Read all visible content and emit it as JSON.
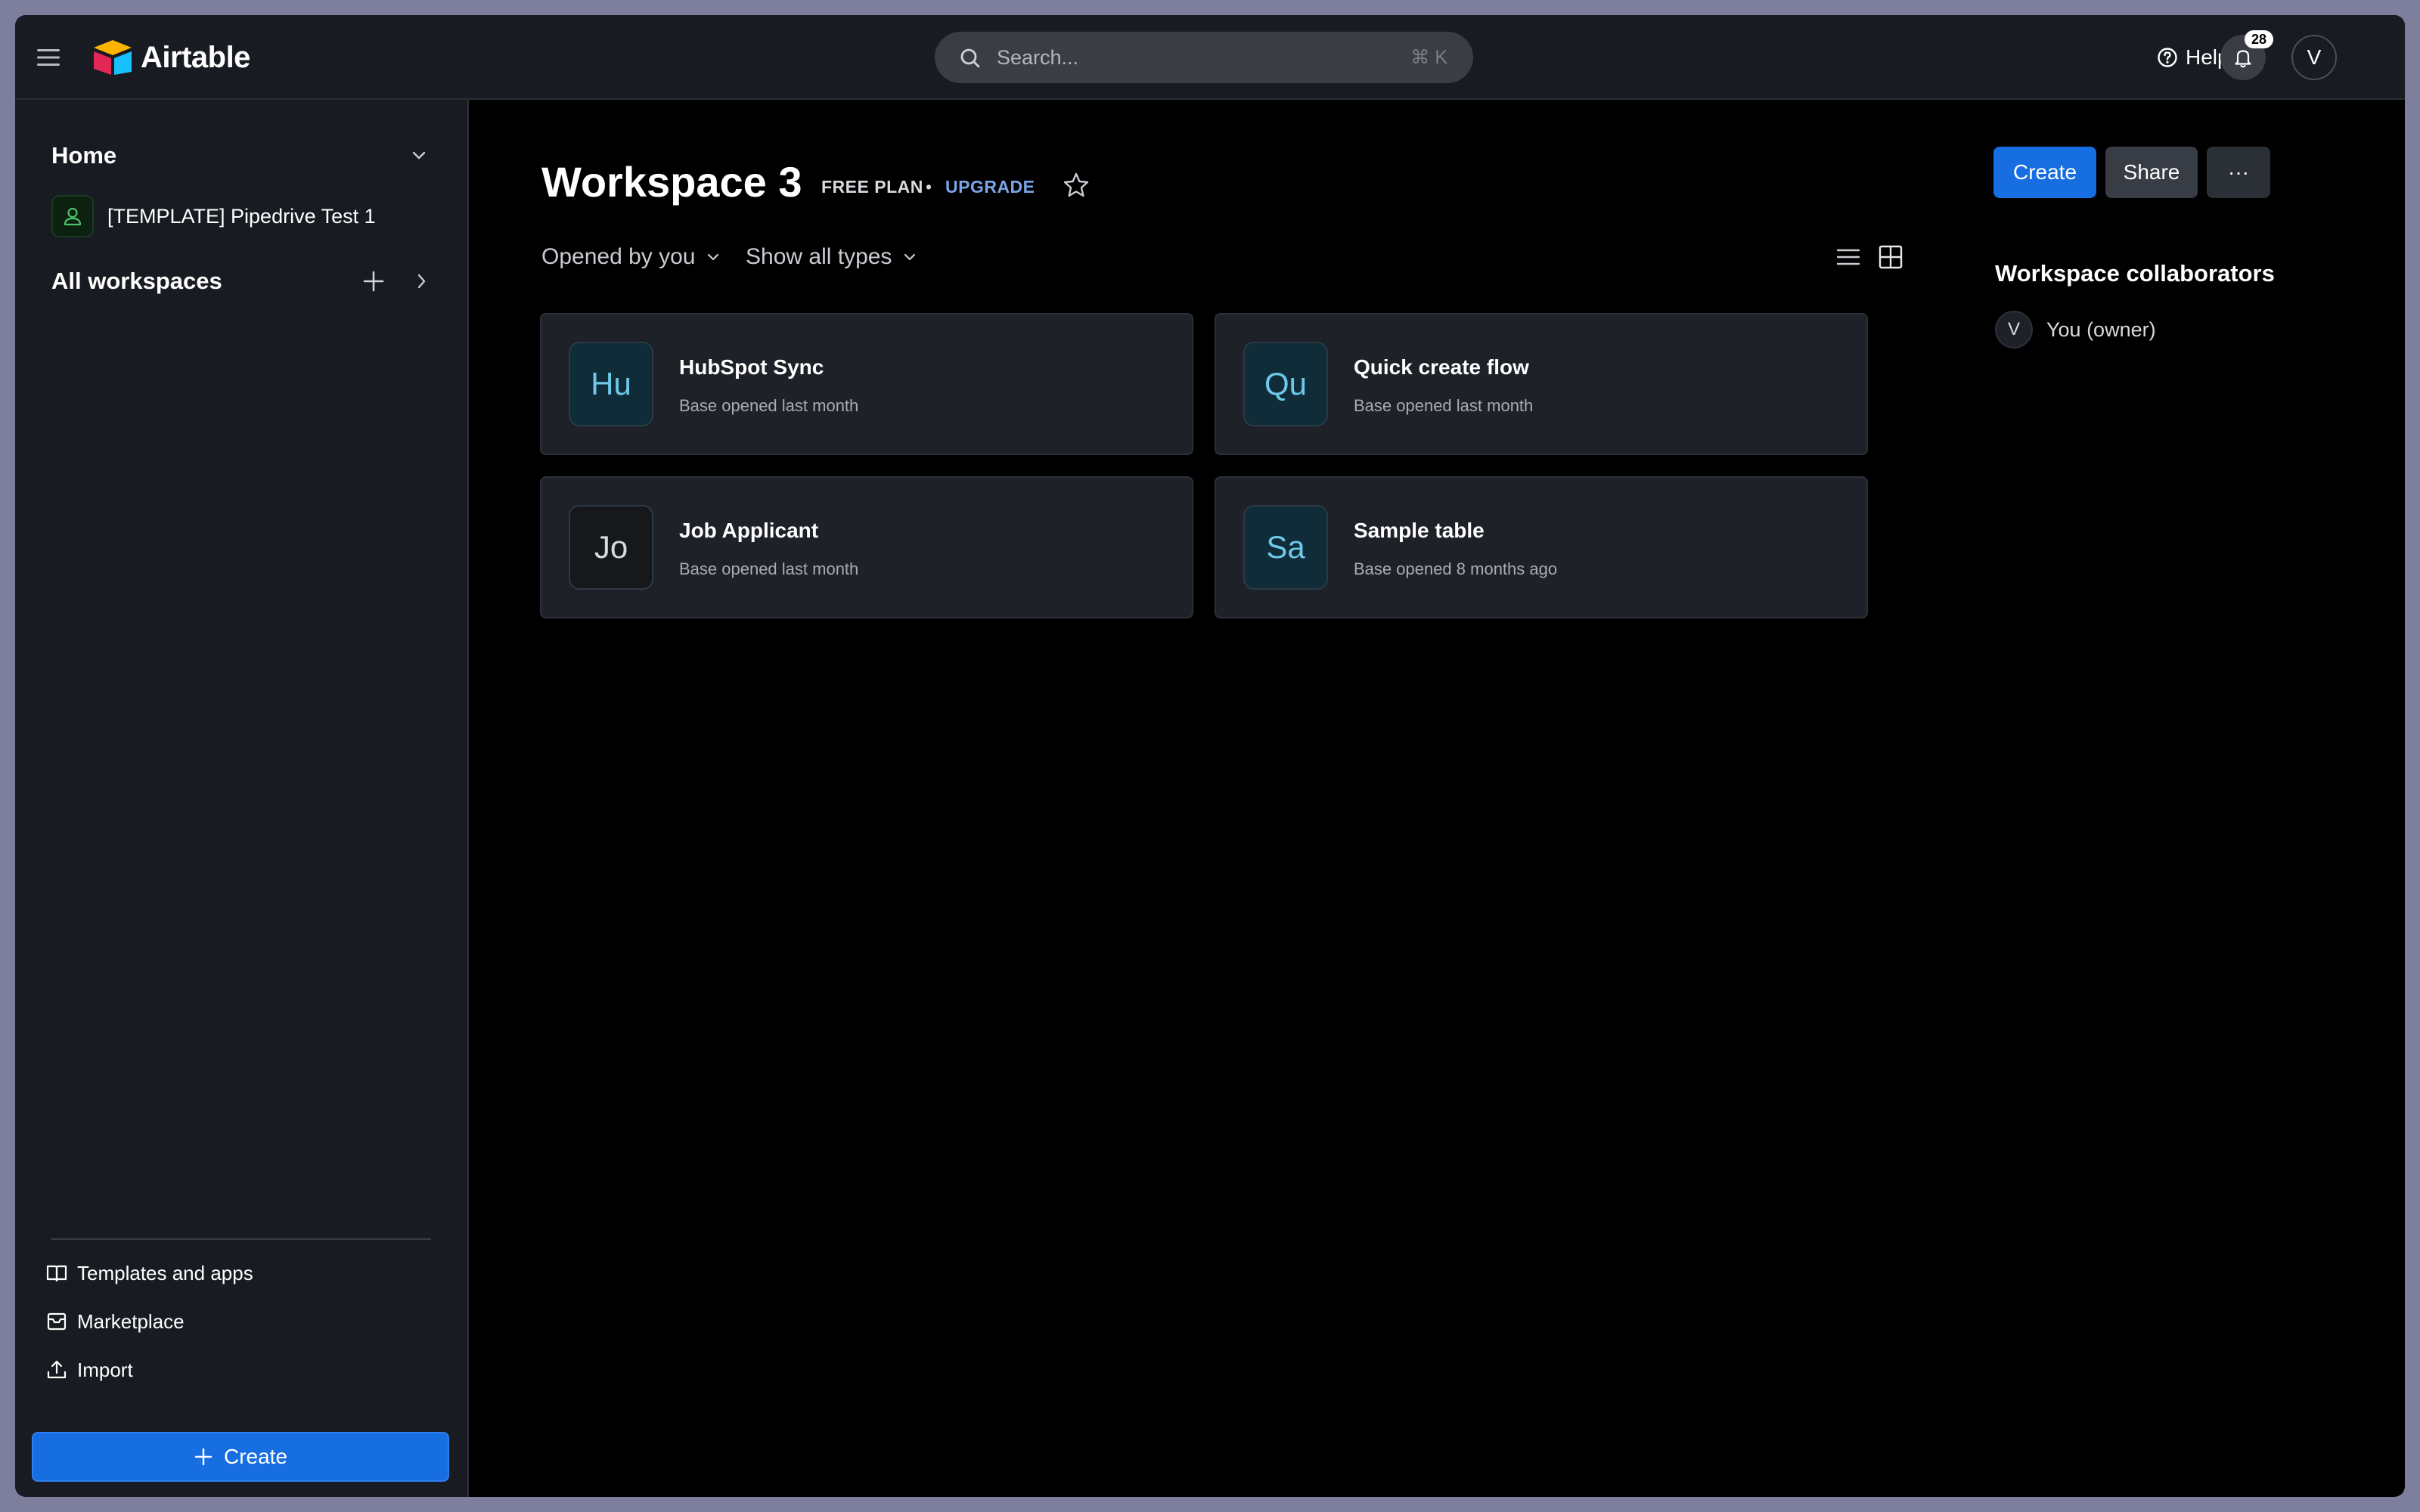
{
  "app": {
    "name": "Airtable"
  },
  "topbar": {
    "search_placeholder": "Search...",
    "search_shortcut": "⌘ K",
    "help_label": "Help",
    "notification_count": "28",
    "avatar_initial": "V"
  },
  "sidebar": {
    "home_label": "Home",
    "bases": [
      {
        "label": "[TEMPLATE] Pipedrive Test 1"
      }
    ],
    "all_workspaces_label": "All workspaces",
    "footer": [
      {
        "label": "Templates and apps",
        "icon": "book-icon"
      },
      {
        "label": "Marketplace",
        "icon": "marketplace-icon"
      },
      {
        "label": "Import",
        "icon": "upload-icon"
      }
    ],
    "create_label": "Create"
  },
  "workspace": {
    "title": "Workspace 3",
    "plan": "FREE PLAN",
    "separator": "•",
    "upgrade": "UPGRADE",
    "create_label": "Create",
    "share_label": "Share",
    "more_label": "···",
    "filter_opened": "Opened by you",
    "filter_types": "Show all types"
  },
  "bases": [
    {
      "initials": "Hu",
      "title": "HubSpot Sync",
      "subtitle": "Base opened last month",
      "color": "#0f2c38",
      "text_color": "#6fc8e8"
    },
    {
      "initials": "Qu",
      "title": "Quick create flow",
      "subtitle": "Base opened last month",
      "color": "#0f2c38",
      "text_color": "#6fc8e8"
    },
    {
      "initials": "Jo",
      "title": "Job Applicant",
      "subtitle": "Base opened last month",
      "color": "#16181c",
      "text_color": "#d8dade"
    },
    {
      "initials": "Sa",
      "title": "Sample table",
      "subtitle": "Base opened 8 months ago",
      "color": "#0f2c38",
      "text_color": "#6fc8e8"
    }
  ],
  "collaborators": {
    "title": "Workspace collaborators",
    "items": [
      {
        "initial": "V",
        "name": "You (owner)"
      }
    ]
  },
  "colors": {
    "accent": "#166ee1",
    "background": "#000000",
    "panel": "#181b21",
    "card": "#1e2127"
  }
}
